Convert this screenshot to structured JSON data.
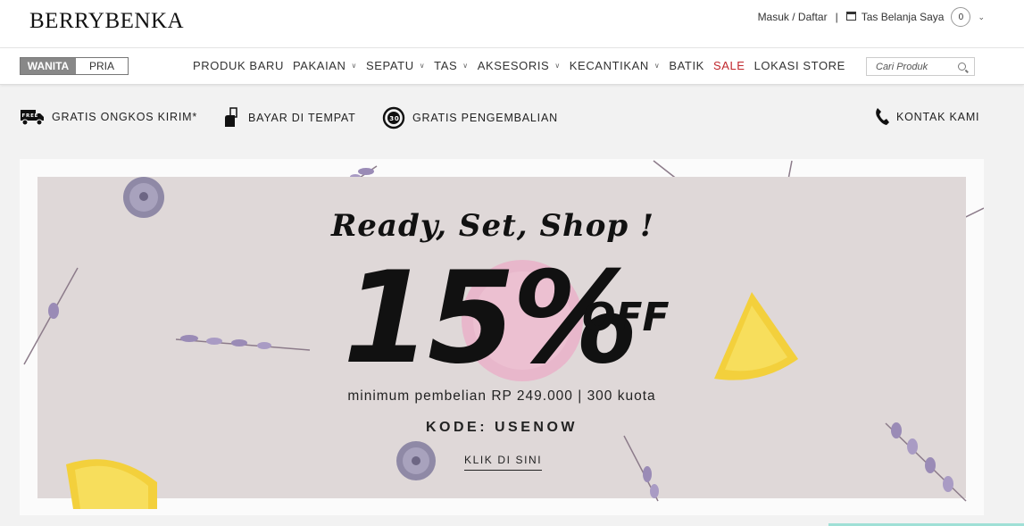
{
  "header": {
    "logo": "BERRYBENKA",
    "login_label": "Masuk / Daftar",
    "bag_label": "Tas Belanja Saya",
    "cart_count": "0"
  },
  "nav": {
    "gender": {
      "active": "WANITA",
      "inactive": "PRIA"
    },
    "items": [
      {
        "label": "PRODUK BARU",
        "dropdown": false
      },
      {
        "label": "PAKAIAN",
        "dropdown": true
      },
      {
        "label": "SEPATU",
        "dropdown": true
      },
      {
        "label": "TAS",
        "dropdown": true
      },
      {
        "label": "AKSESORIS",
        "dropdown": true
      },
      {
        "label": "KECANTIKAN",
        "dropdown": true
      },
      {
        "label": "BATIK",
        "dropdown": false
      },
      {
        "label": "SALE",
        "dropdown": false
      },
      {
        "label": "LOKASI STORE",
        "dropdown": false
      }
    ],
    "search_placeholder": "Cari Produk"
  },
  "benefits": {
    "shipping": "GRATIS ONGKOS KIRIM*",
    "cod": "BAYAR DI TEMPAT",
    "returns": "GRATIS PENGEMBALIAN",
    "contact": "KONTAK KAMI",
    "truck_badge": "FREE",
    "return_badge": "30"
  },
  "banner": {
    "headline": "Ready, Set, Shop !",
    "percent": "15%",
    "off": "OFF",
    "min_purchase": "minimum pembelian RP 249.000 | 300 kuota",
    "code": "KODE: USENOW",
    "cta": "KLIK DI SINI"
  },
  "colors": {
    "sale": "#c0272d",
    "banner_bg": "#dfd8d8",
    "accent_teal": "#9fe0d6"
  }
}
